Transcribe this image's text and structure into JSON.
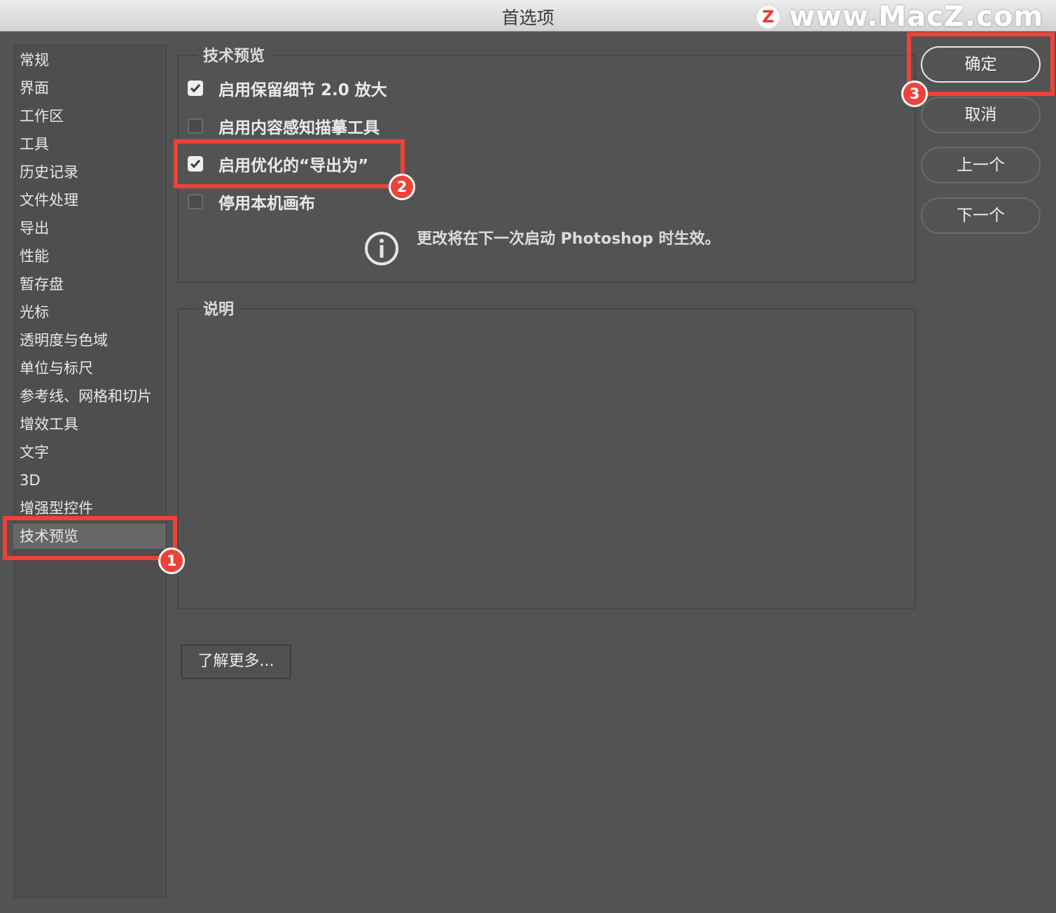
{
  "window": {
    "title": "首选项"
  },
  "watermark": {
    "logo": "Z",
    "text": "www.MacZ.com"
  },
  "sidebar": {
    "items": [
      {
        "label": "常规"
      },
      {
        "label": "界面"
      },
      {
        "label": "工作区"
      },
      {
        "label": "工具"
      },
      {
        "label": "历史记录"
      },
      {
        "label": "文件处理"
      },
      {
        "label": "导出"
      },
      {
        "label": "性能"
      },
      {
        "label": "暂存盘"
      },
      {
        "label": "光标"
      },
      {
        "label": "透明度与色域"
      },
      {
        "label": "单位与标尺"
      },
      {
        "label": "参考线、网格和切片"
      },
      {
        "label": "增效工具"
      },
      {
        "label": "文字"
      },
      {
        "label": "3D"
      },
      {
        "label": "增强型控件"
      },
      {
        "label": "技术预览",
        "selected": true
      }
    ]
  },
  "tech_preview": {
    "group_label": "技术预览",
    "options": [
      {
        "label": "启用保留细节 2.0 放大",
        "checked": true
      },
      {
        "label": "启用内容感知描摹工具",
        "checked": false
      },
      {
        "label": "启用优化的“导出为”",
        "checked": true
      },
      {
        "label": "停用本机画布",
        "checked": false
      }
    ],
    "info_icon": "info-circle-icon",
    "info_text": "更改将在下一次启动 Photoshop 时生效。"
  },
  "description": {
    "group_label": "说明"
  },
  "learn_more": "了解更多...",
  "buttons": {
    "ok": "确定",
    "cancel": "取消",
    "prev": "上一个",
    "next": "下一个"
  },
  "annotations": {
    "badge1": "1",
    "badge2": "2",
    "badge3": "3",
    "color": "#ee4238"
  }
}
